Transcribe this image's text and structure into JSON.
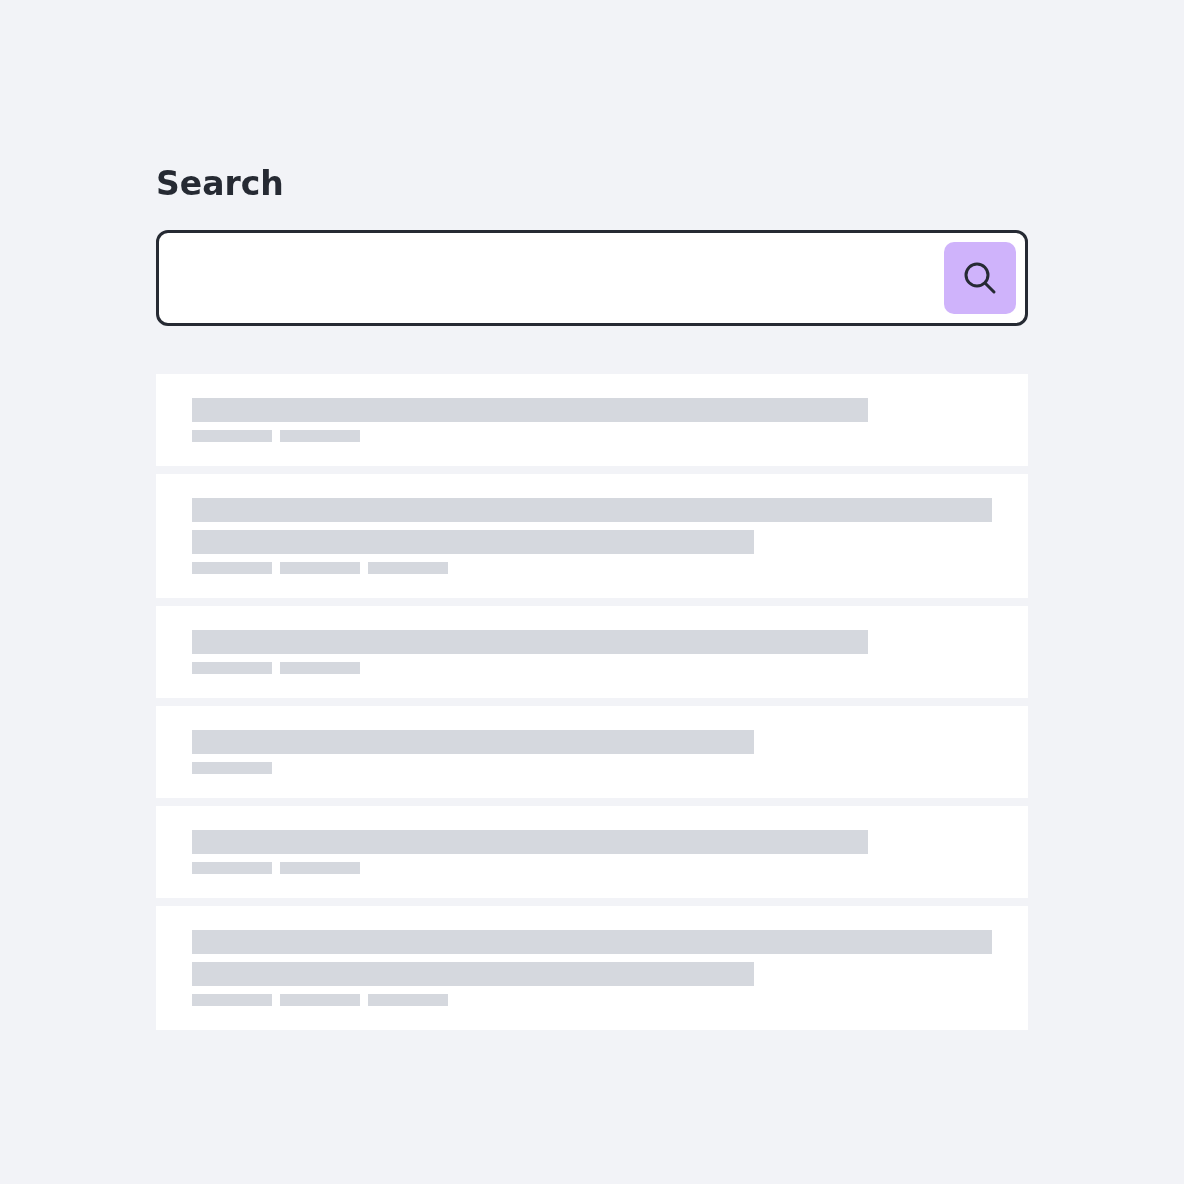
{
  "heading": "Search",
  "results": [
    {
      "lines": [
        {
          "kind": "long"
        }
      ],
      "meta": [
        {
          "kind": "chip"
        },
        {
          "kind": "chip"
        }
      ]
    },
    {
      "lines": [
        {
          "kind": "full"
        },
        {
          "kind": "medium"
        }
      ],
      "meta": [
        {
          "kind": "chip"
        },
        {
          "kind": "chip"
        },
        {
          "kind": "chip"
        }
      ]
    },
    {
      "lines": [
        {
          "kind": "long"
        }
      ],
      "meta": [
        {
          "kind": "chip"
        },
        {
          "kind": "chip"
        }
      ]
    },
    {
      "lines": [
        {
          "kind": "medium"
        }
      ],
      "meta": [
        {
          "kind": "chip"
        }
      ]
    },
    {
      "lines": [
        {
          "kind": "long"
        }
      ],
      "meta": [
        {
          "kind": "chip"
        },
        {
          "kind": "chip"
        }
      ]
    },
    {
      "lines": [
        {
          "kind": "full"
        },
        {
          "kind": "medium"
        }
      ],
      "meta": [
        {
          "kind": "chip"
        },
        {
          "kind": "chip"
        },
        {
          "kind": "chip"
        }
      ]
    }
  ]
}
